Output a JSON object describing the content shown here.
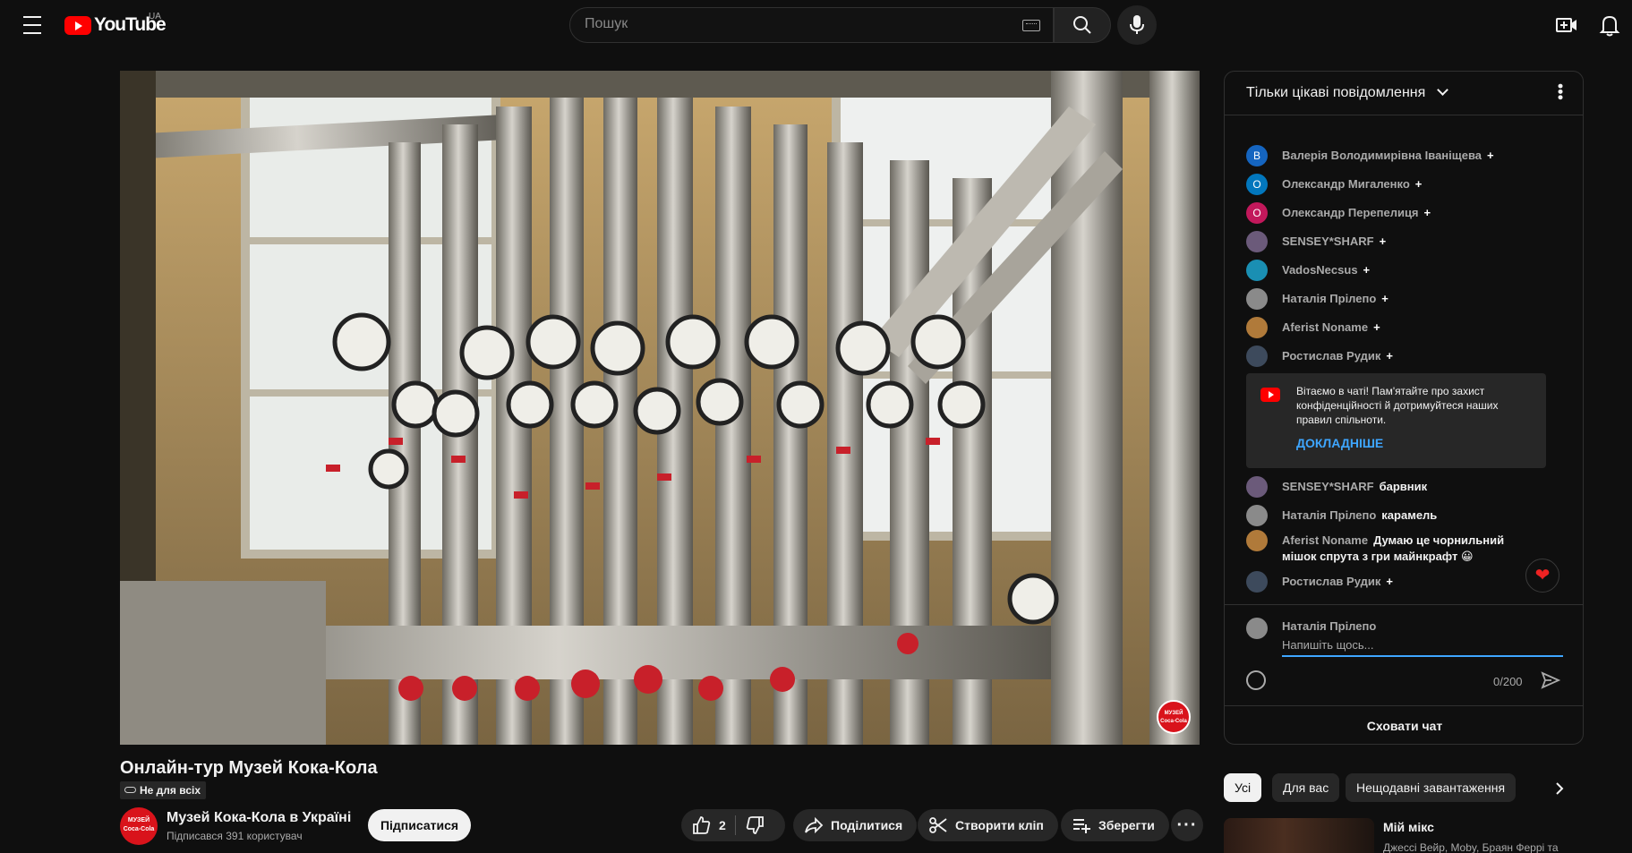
{
  "header": {
    "logo_text": "YouTube",
    "country_code": "UA",
    "search_placeholder": "Пошук"
  },
  "video": {
    "title": "Онлайн-тур Музей Кока-Кола",
    "visibility": "Не для всіх",
    "watermark": "МУЗЕЙ Coca-Cola"
  },
  "channel": {
    "name": "Музей Кока-Кола в Україні",
    "subscribers": "Підписався 391 користувач",
    "avatar_text": "МУЗЕЙ Coca-Cola",
    "subscribe_label": "Підписатися"
  },
  "actions": {
    "likes": "2",
    "share_label": "Поділитися",
    "clip_label": "Створити кліп",
    "save_label": "Зберегти",
    "more_label": "···"
  },
  "chat": {
    "header_title": "Тільки цікаві повідомлення",
    "joins": [
      {
        "author": "Валерія Володимирівна Іваніщева",
        "initial": "В",
        "color": "#1565c0"
      },
      {
        "author": "Олександр Мигаленко",
        "initial": "О",
        "color": "#0277bd"
      },
      {
        "author": "Олександр Перепелиця",
        "initial": "О",
        "color": "#c2185b"
      },
      {
        "author": "SENSEY*SHARF",
        "initial": "",
        "color": "#6b5a7a"
      },
      {
        "author": "VadosNecsus",
        "initial": "",
        "color": "#1a8fb3"
      },
      {
        "author": "Наталія Прілепо",
        "initial": "",
        "color": "#8a8a8a"
      },
      {
        "author": "Aferist Noname",
        "initial": "",
        "color": "#b07a3a"
      },
      {
        "author": "Ростислав Рудик",
        "initial": "",
        "color": "#3d4a5c"
      }
    ],
    "plus": "+",
    "welcome_text": "Вітаємо в чаті! Пам'ятайте про захист конфіденційності й дотримуйтеся наших правил спільноти.",
    "welcome_link": "ДОКЛАДНІШЕ",
    "messages": [
      {
        "author": "SENSEY*SHARF",
        "text": "барвник"
      },
      {
        "author": "Наталія Прілепо",
        "text": "карамель"
      },
      {
        "author": "Aferist Noname",
        "text": "Думаю це чорнильний мішок спрута з гри майнкрафт 😀"
      }
    ],
    "last_join": "Ростислав Рудик",
    "composer_name": "Наталія Прілепо",
    "composer_placeholder": "Напишіть щось...",
    "counter": "0/200",
    "hide_label": "Сховати чат",
    "heart": "❤"
  },
  "chips": [
    "Усі",
    "Для вас",
    "Нещодавні завантаження"
  ],
  "recommendation": {
    "title": "Мій мікс",
    "subtitle": "Джессі Вейр, Moby, Браян Феррі та"
  },
  "colors": {
    "background": "#0f0f0f",
    "brand_red": "#ff0000",
    "link_blue": "#3ea6ff"
  }
}
